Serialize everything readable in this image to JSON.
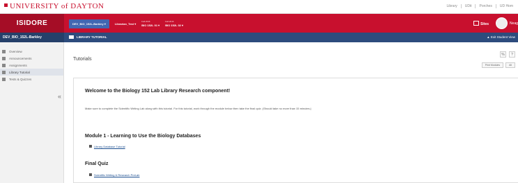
{
  "university": {
    "name": "UNIVERSITY of DAYTON"
  },
  "top_links": [
    "Library",
    "UDit",
    "Porches",
    "UD Hom"
  ],
  "brand": "ISIDORE",
  "site_tabs": [
    {
      "term": "",
      "label": "DEV_BIO_152L-Barkley"
    },
    {
      "term": "",
      "label": "Librarian_Test"
    },
    {
      "term": "Fall 2016",
      "label": "BIO 152L 01"
    },
    {
      "term": "Fall 2016",
      "label": "BIO 152L 02"
    }
  ],
  "header_right": {
    "sites_label": "Sites",
    "user_label": "Neag"
  },
  "site_bar": {
    "site_title": "DEV_BIO_152L-Barkley",
    "tool_title": "LIBRARY TUTORIAL",
    "exit_label": "Exit Student View"
  },
  "sidebar": {
    "items": [
      {
        "label": "Overview"
      },
      {
        "label": "Announcements"
      },
      {
        "label": "Assignments"
      },
      {
        "label": "Library Tutorial"
      },
      {
        "label": "Tests & Quizzes"
      }
    ],
    "collapse": "«"
  },
  "main": {
    "page_title": "Tutorials",
    "tool_icons": [
      "%",
      "?"
    ],
    "edit_buttons": [
      "Print Modules",
      "All"
    ],
    "welcome": "Welcome to the Biology 152 Lab Library Research component!",
    "intro": "Make sure to complete the Scientific Writing Lab along with this tutorial. For this tutorial, work through the module below then take the final quiz. (Should take no more than 15 minutes.)",
    "module_title": "Module 1 - Learning to Use the Biology Databases",
    "module_link": "Library Database Tutorial",
    "quiz_title": "Final Quiz",
    "quiz_link": "Scientific Writing & Research PreLab"
  },
  "colors": {
    "brand_red": "#c8102e",
    "site_bar_blue": "#2d4c7d",
    "active_tab_blue": "#4267b2"
  }
}
